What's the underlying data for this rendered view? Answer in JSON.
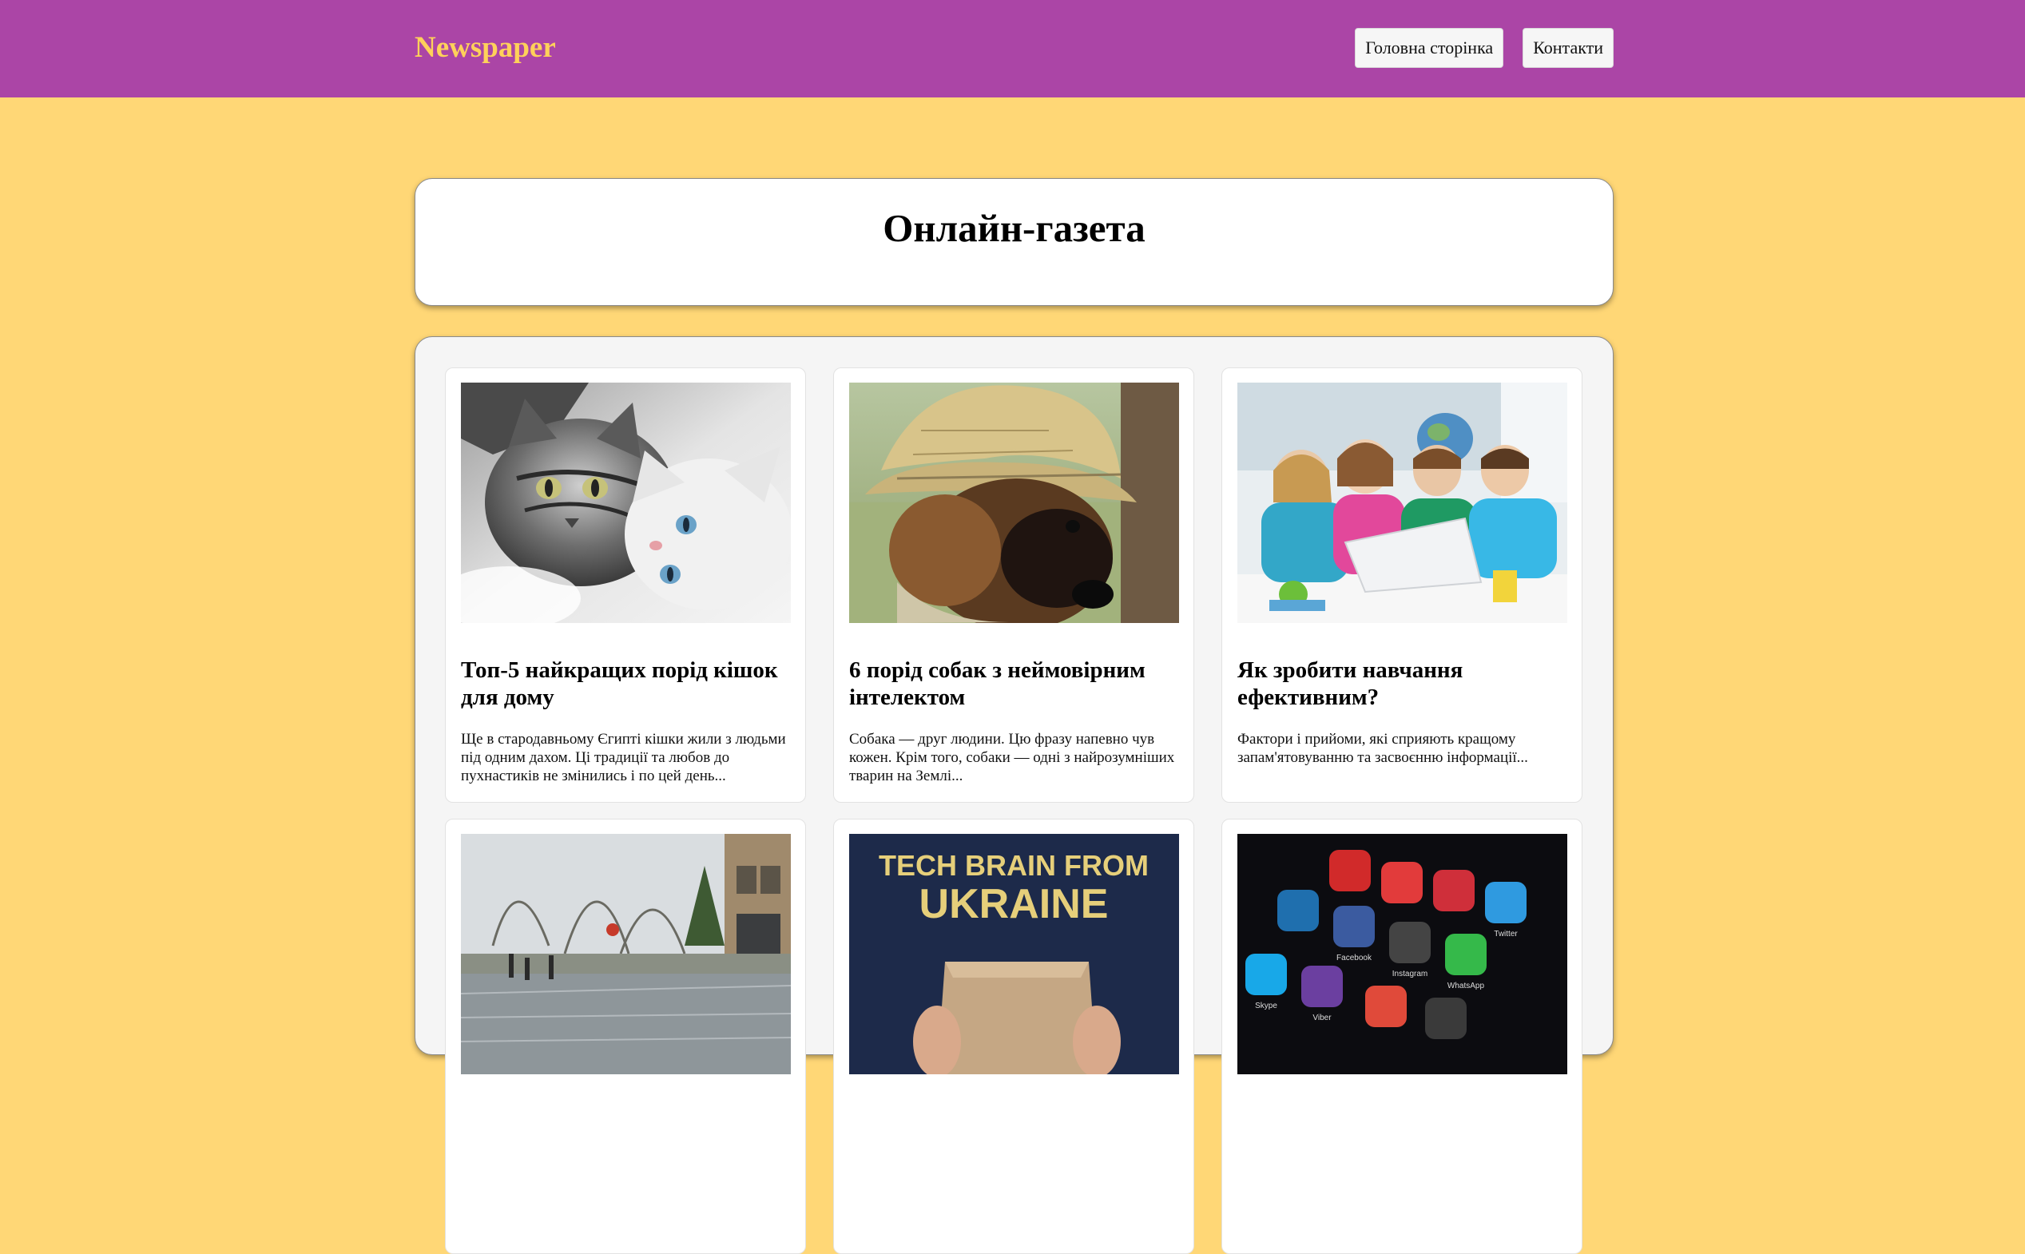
{
  "header": {
    "brand": "Newspaper",
    "nav": [
      {
        "label": "Головна сторінка"
      },
      {
        "label": "Контакти"
      }
    ]
  },
  "hero": {
    "title": "Онлайн-газета"
  },
  "articles": [
    {
      "image": "cats-photo",
      "title": "Топ-5 найкращих порід кішок для дому",
      "excerpt": "Ще в стародавньому Єгипті кішки жили з людьми під одним дахом. Ці традиції та любов до пухнастиків не змінились і по цей день..."
    },
    {
      "image": "puppy-in-hat-photo",
      "title": "6 порід собак з неймовірним інтелектом",
      "excerpt": "Собака — друг людини. Цю фразу напевно чув кожен. Крім того, собаки — одні з найрозумніших тварин на Землі..."
    },
    {
      "image": "children-with-laptop-photo",
      "title": "Як зробити навчання ефективним?",
      "excerpt": "Фактори і прийоми, які сприяють кращому запам'ятовуванню та засвоєнню інформації..."
    },
    {
      "image": "flooded-street-photo",
      "title": "",
      "excerpt": ""
    },
    {
      "image": "tech-brain-shirt-photo",
      "image_text": "TECH BRAIN FROM UKRAINE",
      "title": "",
      "excerpt": ""
    },
    {
      "image": "social-app-icons-photo",
      "app_labels": [
        "Skype",
        "Viber",
        "Facebook",
        "Instagram",
        "WhatsApp",
        "Twitter"
      ],
      "title": "",
      "excerpt": ""
    }
  ],
  "colors": {
    "page_bg": "#ffd776",
    "header_bg": "#ab45a6",
    "brand": "#ffd15a",
    "container_bg": "#f5f5f5",
    "card_bg": "#ffffff"
  }
}
